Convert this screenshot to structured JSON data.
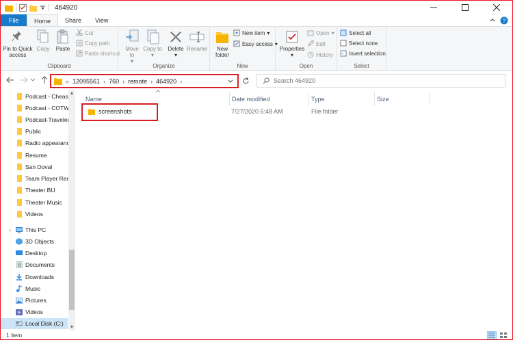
{
  "window": {
    "title": "464920"
  },
  "ribbon_tabs": [
    {
      "label": "File"
    },
    {
      "label": "Home"
    },
    {
      "label": "Share"
    },
    {
      "label": "View"
    }
  ],
  "ribbon": {
    "clipboard": {
      "label": "Clipboard",
      "pin": "Pin to Quick access",
      "copy": "Copy",
      "paste": "Paste",
      "cut": "Cut",
      "copy_path": "Copy path",
      "paste_shortcut": "Paste shortcut"
    },
    "organize": {
      "label": "Organize",
      "move_to": "Move to",
      "copy_to": "Copy to",
      "delete": "Delete",
      "rename": "Rename"
    },
    "new": {
      "label": "New",
      "new_folder": "New folder",
      "new_item": "New item",
      "easy_access": "Easy access"
    },
    "open": {
      "label": "Open",
      "properties": "Properties",
      "open": "Open",
      "edit": "Edit",
      "history": "History"
    },
    "select": {
      "label": "Select",
      "select_all": "Select all",
      "select_none": "Select none",
      "invert": "Invert selection"
    }
  },
  "address": {
    "prefix": "«",
    "crumbs": [
      "12095561",
      "760",
      "remote",
      "464920"
    ]
  },
  "search": {
    "placeholder": "Search 464920"
  },
  "nav_pane": {
    "quick_items": [
      "Podcast - Cheaspe",
      "Podcast - COTW",
      "Podcast-Travelers",
      "Public",
      "Radio appearance",
      "Resume",
      "San Doval",
      "Team Player Rece",
      "Theater BU",
      "Theater Music",
      "Videos"
    ],
    "this_pc": "This PC",
    "pc_items": [
      {
        "label": "3D Objects",
        "icon": "3d-objects-icon"
      },
      {
        "label": "Desktop",
        "icon": "desktop-icon"
      },
      {
        "label": "Documents",
        "icon": "documents-icon"
      },
      {
        "label": "Downloads",
        "icon": "downloads-icon"
      },
      {
        "label": "Music",
        "icon": "music-icon"
      },
      {
        "label": "Pictures",
        "icon": "pictures-icon"
      },
      {
        "label": "Videos",
        "icon": "videos-icon"
      },
      {
        "label": "Local Disk (C:)",
        "icon": "disk-icon"
      }
    ]
  },
  "columns": [
    "Name",
    "Date modified",
    "Type",
    "Size"
  ],
  "files": [
    {
      "name": "screenshots",
      "date": "7/27/2020 6:48 AM",
      "type": "File folder",
      "size": ""
    }
  ],
  "status": {
    "count": "1 item"
  },
  "colors": {
    "accent": "#1979ca",
    "highlight": "#d81e22",
    "folder": "#ffc83d"
  }
}
